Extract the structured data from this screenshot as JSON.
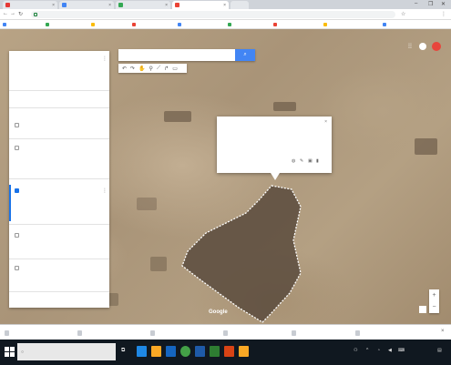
{
  "browser": {
    "tabs": [
      {
        "title": "",
        "favicon_color": "#e53935"
      },
      {
        "title": "",
        "favicon_color": "#4285f4"
      },
      {
        "title": "",
        "favicon_color": "#34a853"
      },
      {
        "title": "",
        "favicon_color": "#ea4335",
        "active": true
      },
      {
        "title": "",
        "favicon_color": "#cccccc"
      }
    ],
    "window_controls": [
      "–",
      "❐",
      "✕"
    ],
    "url": "",
    "bookmarks": [
      {
        "label": "",
        "color": "#4285f4"
      },
      {
        "label": "",
        "color": "#34a853"
      },
      {
        "label": "",
        "color": "#fbbc05"
      },
      {
        "label": "",
        "color": "#ea4335"
      },
      {
        "label": "",
        "color": "#4285f4"
      },
      {
        "label": "",
        "color": "#34a853"
      },
      {
        "label": "",
        "color": "#ea4335"
      },
      {
        "label": "",
        "color": "#fbbc05"
      },
      {
        "label": "",
        "color": "#4285f4"
      }
    ]
  },
  "map": {
    "panel": {
      "map_title": "",
      "map_subtitle": "",
      "drive_label": "",
      "last_edit": "",
      "actions": {
        "add_layer": "",
        "share": "",
        "preview": ""
      },
      "layers": [
        {
          "label": "",
          "checked": false
        },
        {
          "label": "",
          "checked": false
        },
        {
          "label": "",
          "checked": true,
          "sub1": "",
          "sub2": ""
        },
        {
          "label": "",
          "checked": false
        },
        {
          "label": "",
          "checked": false
        },
        {
          "label": "",
          "checked": false
        },
        {
          "label": "",
          "checked": false
        }
      ],
      "base_map": ""
    },
    "popup": {
      "title": "",
      "description": "",
      "measurement": ""
    },
    "footer": ""
  },
  "downloads": [
    "",
    "",
    "",
    "",
    "",
    ""
  ],
  "downloads_show_all": "",
  "taskbar": {
    "search_placeholder": "",
    "icons": [
      {
        "name": "edge",
        "color": "#1e88e5"
      },
      {
        "name": "file-explorer",
        "color": "#f9a825"
      },
      {
        "name": "store",
        "color": "#1565c0"
      },
      {
        "name": "chrome",
        "color": "#43a047"
      },
      {
        "name": "word",
        "color": "#1e5aa8"
      },
      {
        "name": "excel",
        "color": "#2e7d32"
      },
      {
        "name": "powerpoint",
        "color": "#d84315"
      },
      {
        "name": "paint",
        "color": "#f9a825"
      }
    ],
    "clock": [
      "",
      ""
    ]
  },
  "colors": {
    "accent": "#4285f4",
    "polygon_fill": "#5a4b3d"
  }
}
